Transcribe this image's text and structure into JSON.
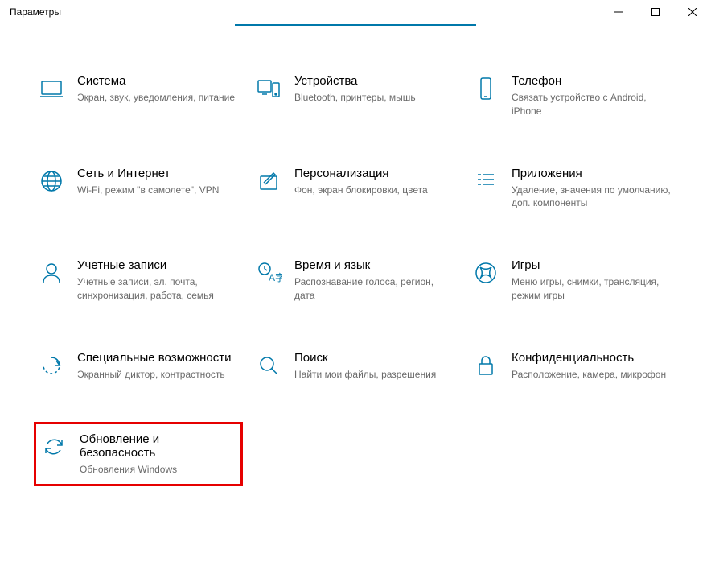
{
  "window": {
    "title": "Параметры"
  },
  "tiles": [
    {
      "title": "Система",
      "desc": "Экран, звук, уведомления, питание"
    },
    {
      "title": "Устройства",
      "desc": "Bluetooth, принтеры, мышь"
    },
    {
      "title": "Телефон",
      "desc": "Связать устройство с Android, iPhone"
    },
    {
      "title": "Сеть и Интернет",
      "desc": "Wi-Fi, режим \"в самолете\", VPN"
    },
    {
      "title": "Персонализация",
      "desc": "Фон, экран блокировки, цвета"
    },
    {
      "title": "Приложения",
      "desc": "Удаление, значения по умолчанию, доп. компоненты"
    },
    {
      "title": "Учетные записи",
      "desc": "Учетные записи, эл. почта, синхронизация, работа, семья"
    },
    {
      "title": "Время и язык",
      "desc": "Распознавание голоса, регион, дата"
    },
    {
      "title": "Игры",
      "desc": "Меню игры, снимки, трансляция, режим игры"
    },
    {
      "title": "Специальные возможности",
      "desc": "Экранный диктор, контрастность"
    },
    {
      "title": "Поиск",
      "desc": "Найти мои файлы, разрешения"
    },
    {
      "title": "Конфиденциальность",
      "desc": "Расположение, камера, микрофон"
    },
    {
      "title": "Обновление и безопасность",
      "desc": "Обновления Windows"
    }
  ]
}
